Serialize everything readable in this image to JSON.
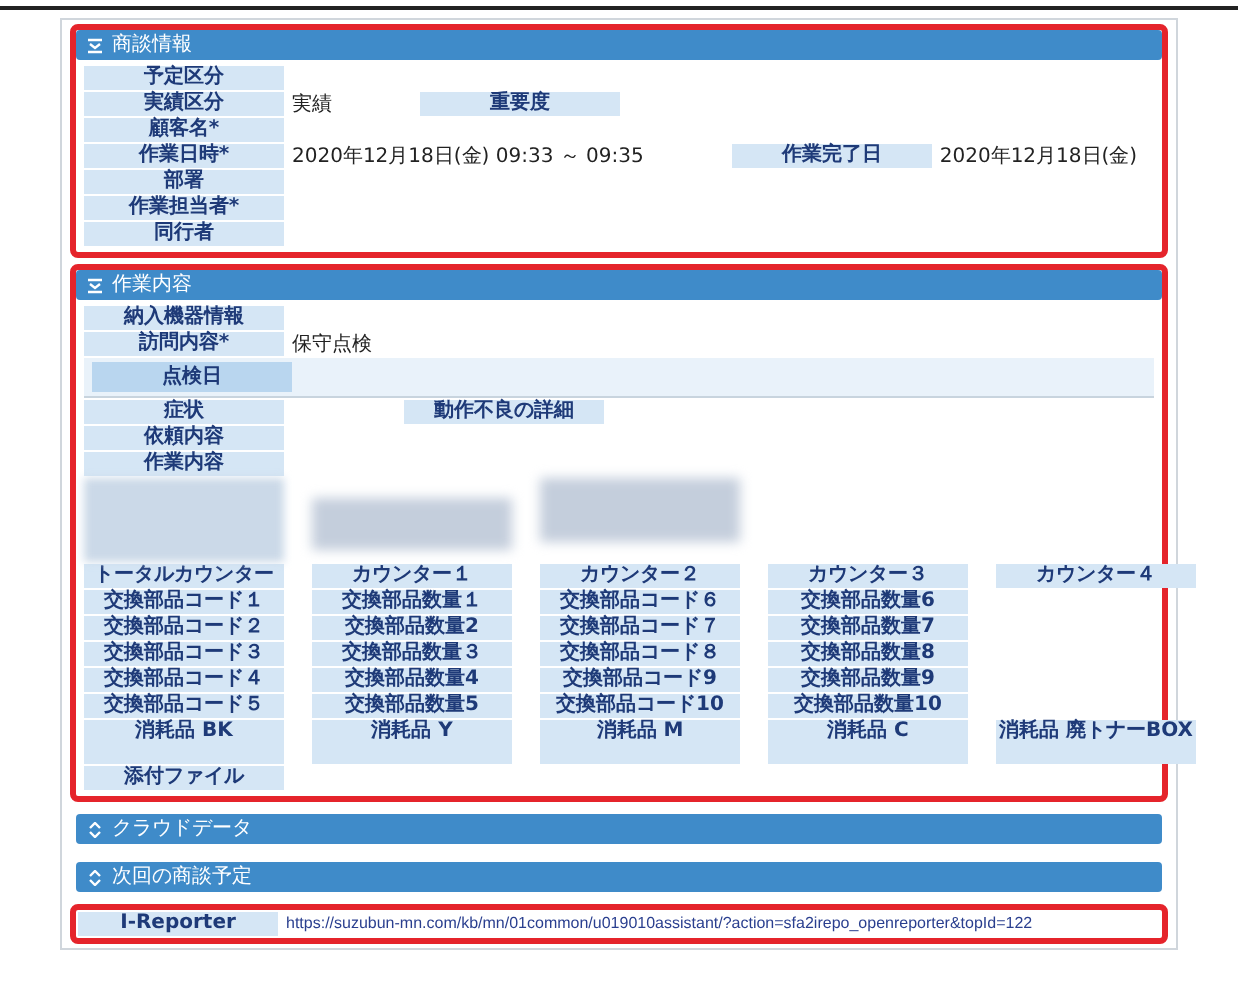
{
  "sections": [
    {
      "title": "商談情報",
      "expanded": true,
      "highlighted": true,
      "items": [
        {
          "kind": "field",
          "fields": [
            {
              "label": "予定区分"
            }
          ]
        },
        {
          "kind": "field",
          "fields": [
            {
              "label": "実績区分",
              "value": "実績"
            },
            {
              "label": "重要度"
            }
          ]
        },
        {
          "kind": "field",
          "fields": [
            {
              "label": "顧客名*"
            }
          ]
        },
        {
          "kind": "field",
          "fields": [
            {
              "label": "作業日時*",
              "value": "2020年12月18日(金) 09:33 ～ 09:35"
            },
            {
              "label": "作業完了日",
              "value": "2020年12月18日(金)"
            }
          ]
        },
        {
          "kind": "field",
          "fields": [
            {
              "label": "部署"
            }
          ]
        },
        {
          "kind": "field",
          "fields": [
            {
              "label": "作業担当者*"
            }
          ]
        },
        {
          "kind": "field",
          "fields": [
            {
              "label": "同行者"
            }
          ]
        }
      ]
    },
    {
      "title": "作業内容",
      "expanded": true,
      "highlighted": true,
      "items": [
        {
          "kind": "field",
          "fields": [
            {
              "label": "納入機器情報"
            }
          ]
        },
        {
          "kind": "field",
          "fields": [
            {
              "label": "訪問内容*",
              "value": "保守点検"
            }
          ]
        },
        {
          "kind": "band",
          "fields": [
            {
              "label": "点検日"
            }
          ]
        },
        {
          "kind": "field",
          "fields": [
            {
              "label": "症状"
            },
            {
              "label": "動作不良の詳細"
            }
          ]
        },
        {
          "kind": "field",
          "fields": [
            {
              "label": "依頼内容"
            }
          ]
        },
        {
          "kind": "field",
          "fields": [
            {
              "label": "作業内容"
            }
          ]
        },
        {
          "kind": "redacted"
        },
        {
          "kind": "grid",
          "rows": [
            [
              "トータルカウンター",
              "カウンター１",
              "カウンター２",
              "カウンター３",
              "カウンター４"
            ],
            [
              "交換部品コード１",
              "交換部品数量１",
              "交換部品コード６",
              "交換部品数量6",
              null
            ],
            [
              "交換部品コード２",
              "交換部品数量2",
              "交換部品コード７",
              "交換部品数量7",
              null
            ],
            [
              "交換部品コード３",
              "交換部品数量３",
              "交換部品コード８",
              "交換部品数量8",
              null
            ],
            [
              "交換部品コード４",
              "交換部品数量4",
              "交換部品コード9",
              "交換部品数量9",
              null
            ],
            [
              "交換部品コード５",
              "交換部品数量5",
              "交換部品コード10",
              "交換部品数量10",
              null
            ],
            [
              "消耗品 BK",
              "消耗品 Y",
              "消耗品 M",
              "消耗品 C",
              "消耗品 廃トナーBOX"
            ],
            [
              "添付ファイル",
              null,
              null,
              null,
              null
            ]
          ]
        }
      ]
    },
    {
      "title": "クラウドデータ",
      "expanded": false,
      "highlighted": false
    },
    {
      "title": "次回の商談予定",
      "expanded": false,
      "highlighted": false
    }
  ],
  "reporter": {
    "label": "I-Reporter",
    "link": "https://suzubun-mn.com/kb/mn/01common/u019010assistant/?action=sfa2irepo_openreporter&topId=122",
    "highlighted": true
  }
}
